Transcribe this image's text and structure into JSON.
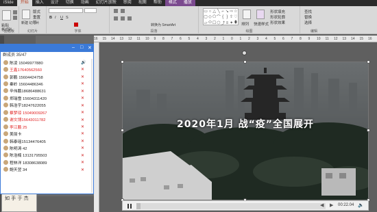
{
  "ribbon": {
    "tabs": [
      {
        "label": "iSlide",
        "active": false,
        "ctx": false
      },
      {
        "label": "开始",
        "active": true,
        "ctx": false
      },
      {
        "label": "插入",
        "active": false,
        "ctx": false
      },
      {
        "label": "设计",
        "active": false,
        "ctx": false
      },
      {
        "label": "切换",
        "active": false,
        "ctx": false
      },
      {
        "label": "动画",
        "active": false,
        "ctx": false
      },
      {
        "label": "幻灯片放映",
        "active": false,
        "ctx": false
      },
      {
        "label": "审阅",
        "active": false,
        "ctx": false
      },
      {
        "label": "视图",
        "active": false,
        "ctx": false
      },
      {
        "label": "帮助",
        "active": false,
        "ctx": false
      },
      {
        "label": "格式",
        "active": false,
        "ctx": true
      },
      {
        "label": "播放",
        "active": false,
        "ctx": true
      }
    ],
    "groups": {
      "clipboard": "剪贴板",
      "slides": "幻灯片",
      "font": "字体",
      "paragraph": "段落",
      "drawing": "绘图",
      "editing": "编辑"
    },
    "clipboard": {
      "paste": "粘贴",
      "format_painter": "格式刷"
    },
    "slides": {
      "new_slide": "新建\n幻灯片",
      "layout": "版式",
      "reset": "重置",
      "section": "节"
    },
    "paragraph": {
      "convert_smartart": "转换为 SmartArt"
    },
    "drawing": {
      "arrange": "排列",
      "quick_styles": "快速样式",
      "shape_fill": "形状填充",
      "shape_outline": "形状轮廓",
      "shape_effects": "形状效果"
    },
    "editing": {
      "find": "查找",
      "replace": "替换",
      "select": "选择"
    }
  },
  "ruler": {
    "marks": [
      "16",
      "15",
      "14",
      "13",
      "12",
      "11",
      "10",
      "9",
      "8",
      "7",
      "6",
      "5",
      "4",
      "3",
      "2",
      "1",
      "0",
      "1",
      "2",
      "3",
      "4",
      "5",
      "6",
      "7",
      "8",
      "9",
      "10",
      "11",
      "12",
      "13",
      "14",
      "15",
      "16"
    ]
  },
  "panel": {
    "title": "群成员 35/47",
    "members": [
      {
        "name": "陈凌 15049977880",
        "raised": false,
        "mic": "on"
      },
      {
        "name": "王鑫17640562560",
        "raised": true,
        "mic": "off"
      },
      {
        "name": "郭鹏 15604424758",
        "raised": false,
        "mic": "off"
      },
      {
        "name": "秦岭 15604486346",
        "raised": false,
        "mic": "off"
      },
      {
        "name": "辛伟鹏18686488631",
        "raised": false,
        "mic": "off"
      },
      {
        "name": "郑瑞雪 15604311420",
        "raised": false,
        "mic": "off"
      },
      {
        "name": "韩浩宇18247622055",
        "raised": false,
        "mic": "off"
      },
      {
        "name": "蔡梦琼 15049009267",
        "raised": true,
        "mic": "off"
      },
      {
        "name": "谢文博15643011782",
        "raised": true,
        "mic": "off"
      },
      {
        "name": "李江鹏 25",
        "raised": true,
        "mic": "off"
      },
      {
        "name": "美丽卡",
        "raised": false,
        "mic": "off"
      },
      {
        "name": "韩泰瑶15134476405",
        "raised": false,
        "mic": "off"
      },
      {
        "name": "陈明涛 42",
        "raised": false,
        "mic": "off"
      },
      {
        "name": "陈浩楠 13131795503",
        "raised": false,
        "mic": "off"
      },
      {
        "name": "程林洋 18308638089",
        "raised": false,
        "mic": "off"
      },
      {
        "name": "鲍天翌 34",
        "raised": false,
        "mic": "off"
      }
    ]
  },
  "slide_thumb": {
    "ink": "如 手 于 杰"
  },
  "video": {
    "caption": "2020年1月  战“疫”全国展开",
    "time": "00:22.04",
    "progress": 0.02
  },
  "icons": {
    "pause": "pause-icon",
    "prev": "◀",
    "next": "▶",
    "volume": "🔈",
    "mic_on": "🔊",
    "mic_off": "✕"
  },
  "colors": {
    "accent": "#3b7ad8",
    "raised": "#e02020",
    "ctx_tab": "#7b4a8f"
  }
}
